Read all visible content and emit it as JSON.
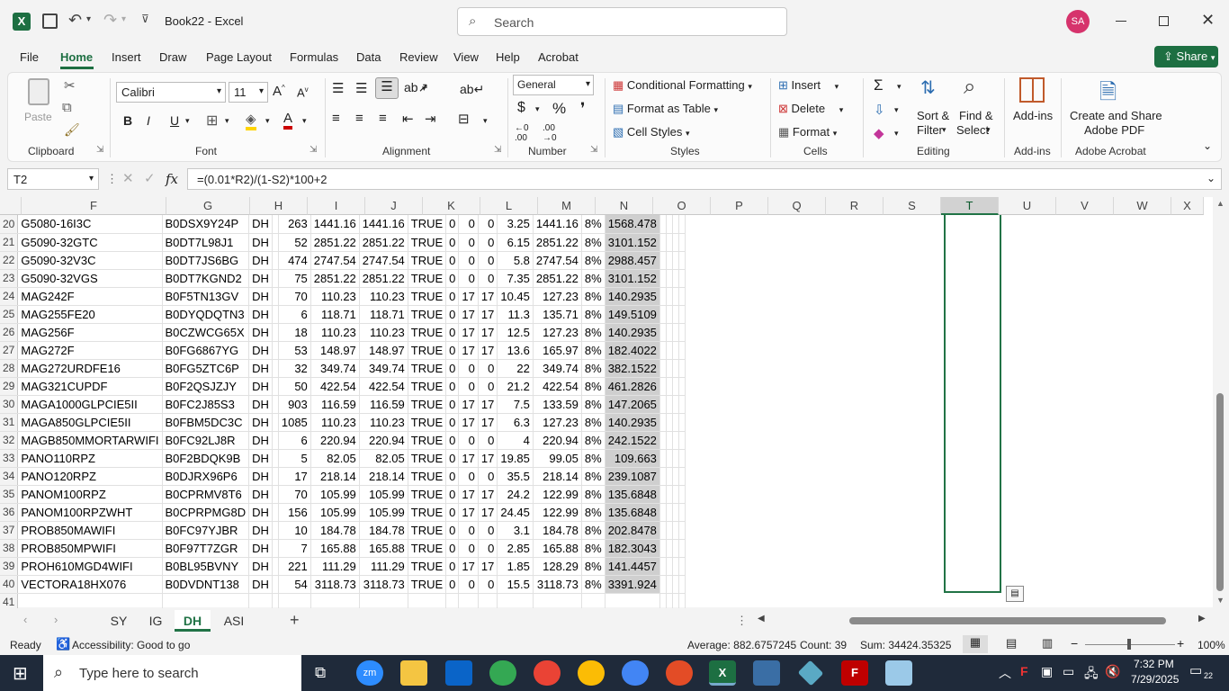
{
  "app": {
    "title": "Book22  -  Excel",
    "search_placeholder": "Search",
    "user_initials": "SA"
  },
  "menu": {
    "tabs": [
      "File",
      "Home",
      "Insert",
      "Draw",
      "Page Layout",
      "Formulas",
      "Data",
      "Review",
      "View",
      "Help",
      "Acrobat"
    ],
    "active": "Home",
    "share": "Share"
  },
  "ribbon": {
    "clipboard": {
      "label": "Clipboard",
      "paste": "Paste"
    },
    "font": {
      "label": "Font",
      "name": "Calibri",
      "size": "11",
      "bold": "B",
      "italic": "I",
      "underline": "U"
    },
    "alignment": {
      "label": "Alignment"
    },
    "number": {
      "label": "Number",
      "format": "General"
    },
    "styles": {
      "label": "Styles",
      "conditional": "Conditional Formatting",
      "format_table": "Format as Table",
      "cell_styles": "Cell Styles"
    },
    "cells": {
      "label": "Cells",
      "insert": "Insert",
      "delete": "Delete",
      "format": "Format"
    },
    "editing": {
      "label": "Editing",
      "sort": "Sort &",
      "filter": "Filter",
      "find": "Find &",
      "select": "Select"
    },
    "addins": {
      "label": "Add-ins",
      "btn": "Add-ins"
    },
    "acrobat": {
      "label": "Adobe Acrobat",
      "line1": "Create and Share",
      "line2": "Adobe PDF"
    }
  },
  "formula_bar": {
    "name_box": "T2",
    "fx": "fx",
    "formula": "=(0.01*R2)/(1-S2)*100+2"
  },
  "columns": [
    "F",
    "G",
    "H",
    "I",
    "J",
    "K",
    "L",
    "M",
    "N",
    "O",
    "P",
    "Q",
    "R",
    "S",
    "T",
    "U",
    "V",
    "W",
    "X"
  ],
  "selected_column": "T",
  "rows": [
    {
      "n": "20",
      "F": "G5080-16I3C",
      "G": "B0DSX9Y24P",
      "H": "DH",
      "J": "263",
      "K": "1441.16",
      "L": "1441.16",
      "M": "TRUE",
      "N": "0",
      "O": "0",
      "P": "0",
      "Q": "3.25",
      "R": "1441.16",
      "S": "8%",
      "T": "1568.478"
    },
    {
      "n": "21",
      "F": "G5090-32GTC",
      "G": "B0DT7L98J1",
      "H": "DH",
      "J": "52",
      "K": "2851.22",
      "L": "2851.22",
      "M": "TRUE",
      "N": "0",
      "O": "0",
      "P": "0",
      "Q": "6.15",
      "R": "2851.22",
      "S": "8%",
      "T": "3101.152"
    },
    {
      "n": "22",
      "F": "G5090-32V3C",
      "G": "B0DT7JS6BG",
      "H": "DH",
      "J": "474",
      "K": "2747.54",
      "L": "2747.54",
      "M": "TRUE",
      "N": "0",
      "O": "0",
      "P": "0",
      "Q": "5.8",
      "R": "2747.54",
      "S": "8%",
      "T": "2988.457"
    },
    {
      "n": "23",
      "F": "G5090-32VGS",
      "G": "B0DT7KGND2",
      "H": "DH",
      "J": "75",
      "K": "2851.22",
      "L": "2851.22",
      "M": "TRUE",
      "N": "0",
      "O": "0",
      "P": "0",
      "Q": "7.35",
      "R": "2851.22",
      "S": "8%",
      "T": "3101.152"
    },
    {
      "n": "24",
      "F": "MAG242F",
      "G": "B0F5TN13GV",
      "H": "DH",
      "J": "70",
      "K": "110.23",
      "L": "110.23",
      "M": "TRUE",
      "N": "0",
      "O": "17",
      "P": "17",
      "Q": "10.45",
      "R": "127.23",
      "S": "8%",
      "T": "140.2935"
    },
    {
      "n": "25",
      "F": "MAG255FE20",
      "G": "B0DYQDQTN3",
      "H": "DH",
      "J": "6",
      "K": "118.71",
      "L": "118.71",
      "M": "TRUE",
      "N": "0",
      "O": "17",
      "P": "17",
      "Q": "11.3",
      "R": "135.71",
      "S": "8%",
      "T": "149.5109"
    },
    {
      "n": "26",
      "F": "MAG256F",
      "G": "B0CZWCG65X",
      "H": "DH",
      "J": "18",
      "K": "110.23",
      "L": "110.23",
      "M": "TRUE",
      "N": "0",
      "O": "17",
      "P": "17",
      "Q": "12.5",
      "R": "127.23",
      "S": "8%",
      "T": "140.2935"
    },
    {
      "n": "27",
      "F": "MAG272F",
      "G": "B0FG6867YG",
      "H": "DH",
      "J": "53",
      "K": "148.97",
      "L": "148.97",
      "M": "TRUE",
      "N": "0",
      "O": "17",
      "P": "17",
      "Q": "13.6",
      "R": "165.97",
      "S": "8%",
      "T": "182.4022"
    },
    {
      "n": "28",
      "F": "MAG272URDFE16",
      "G": "B0FG5ZTC6P",
      "H": "DH",
      "J": "32",
      "K": "349.74",
      "L": "349.74",
      "M": "TRUE",
      "N": "0",
      "O": "0",
      "P": "0",
      "Q": "22",
      "R": "349.74",
      "S": "8%",
      "T": "382.1522"
    },
    {
      "n": "29",
      "F": "MAG321CUPDF",
      "G": "B0F2QSJZJY",
      "H": "DH",
      "J": "50",
      "K": "422.54",
      "L": "422.54",
      "M": "TRUE",
      "N": "0",
      "O": "0",
      "P": "0",
      "Q": "21.2",
      "R": "422.54",
      "S": "8%",
      "T": "461.2826"
    },
    {
      "n": "30",
      "F": "MAGA1000GLPCIE5II",
      "G": "B0FC2J85S3",
      "H": "DH",
      "J": "903",
      "K": "116.59",
      "L": "116.59",
      "M": "TRUE",
      "N": "0",
      "O": "17",
      "P": "17",
      "Q": "7.5",
      "R": "133.59",
      "S": "8%",
      "T": "147.2065"
    },
    {
      "n": "31",
      "F": "MAGA850GLPCIE5II",
      "G": "B0FBM5DC3C",
      "H": "DH",
      "J": "1085",
      "K": "110.23",
      "L": "110.23",
      "M": "TRUE",
      "N": "0",
      "O": "17",
      "P": "17",
      "Q": "6.3",
      "R": "127.23",
      "S": "8%",
      "T": "140.2935"
    },
    {
      "n": "32",
      "F": "MAGB850MMORTARWIFI",
      "G": "B0FC92LJ8R",
      "H": "DH",
      "J": "6",
      "K": "220.94",
      "L": "220.94",
      "M": "TRUE",
      "N": "0",
      "O": "0",
      "P": "0",
      "Q": "4",
      "R": "220.94",
      "S": "8%",
      "T": "242.1522"
    },
    {
      "n": "33",
      "F": "PANO110RPZ",
      "G": "B0F2BDQK9B",
      "H": "DH",
      "J": "5",
      "K": "82.05",
      "L": "82.05",
      "M": "TRUE",
      "N": "0",
      "O": "17",
      "P": "17",
      "Q": "19.85",
      "R": "99.05",
      "S": "8%",
      "T": "109.663"
    },
    {
      "n": "34",
      "F": "PANO120RPZ",
      "G": "B0DJRX96P6",
      "H": "DH",
      "J": "17",
      "K": "218.14",
      "L": "218.14",
      "M": "TRUE",
      "N": "0",
      "O": "0",
      "P": "0",
      "Q": "35.5",
      "R": "218.14",
      "S": "8%",
      "T": "239.1087"
    },
    {
      "n": "35",
      "F": "PANOM100RPZ",
      "G": "B0CPRMV8T6",
      "H": "DH",
      "J": "70",
      "K": "105.99",
      "L": "105.99",
      "M": "TRUE",
      "N": "0",
      "O": "17",
      "P": "17",
      "Q": "24.2",
      "R": "122.99",
      "S": "8%",
      "T": "135.6848"
    },
    {
      "n": "36",
      "F": "PANOM100RPZWHT",
      "G": "B0CPRPMG8D",
      "H": "DH",
      "J": "156",
      "K": "105.99",
      "L": "105.99",
      "M": "TRUE",
      "N": "0",
      "O": "17",
      "P": "17",
      "Q": "24.45",
      "R": "122.99",
      "S": "8%",
      "T": "135.6848"
    },
    {
      "n": "37",
      "F": "PROB850MAWIFI",
      "G": "B0FC97YJBR",
      "H": "DH",
      "J": "10",
      "K": "184.78",
      "L": "184.78",
      "M": "TRUE",
      "N": "0",
      "O": "0",
      "P": "0",
      "Q": "3.1",
      "R": "184.78",
      "S": "8%",
      "T": "202.8478"
    },
    {
      "n": "38",
      "F": "PROB850MPWIFI",
      "G": "B0F97T7ZGR",
      "H": "DH",
      "J": "7",
      "K": "165.88",
      "L": "165.88",
      "M": "TRUE",
      "N": "0",
      "O": "0",
      "P": "0",
      "Q": "2.85",
      "R": "165.88",
      "S": "8%",
      "T": "182.3043"
    },
    {
      "n": "39",
      "F": "PROH610MGD4WIFI",
      "G": "B0BL95BVNY",
      "H": "DH",
      "J": "221",
      "K": "111.29",
      "L": "111.29",
      "M": "TRUE",
      "N": "0",
      "O": "17",
      "P": "17",
      "Q": "1.85",
      "R": "128.29",
      "S": "8%",
      "T": "141.4457"
    },
    {
      "n": "40",
      "F": "VECTORA18HX076",
      "G": "B0DVDNT138",
      "H": "DH",
      "J": "54",
      "K": "3118.73",
      "L": "3118.73",
      "M": "TRUE",
      "N": "0",
      "O": "0",
      "P": "0",
      "Q": "15.5",
      "R": "3118.73",
      "S": "8%",
      "T": "3391.924"
    },
    {
      "n": "41"
    }
  ],
  "sheets": [
    "SY",
    "IG",
    "DH",
    "ASI"
  ],
  "active_sheet": "DH",
  "status": {
    "ready": "Ready",
    "accessibility": "Accessibility: Good to go",
    "average": "Average: 882.6757245",
    "count": "Count: 39",
    "sum": "Sum: 34424.35325",
    "zoom": "100%"
  },
  "taskbar": {
    "search_placeholder": "Type here to search",
    "time": "7:32 PM",
    "date": "7/29/2025",
    "notif": "22"
  }
}
